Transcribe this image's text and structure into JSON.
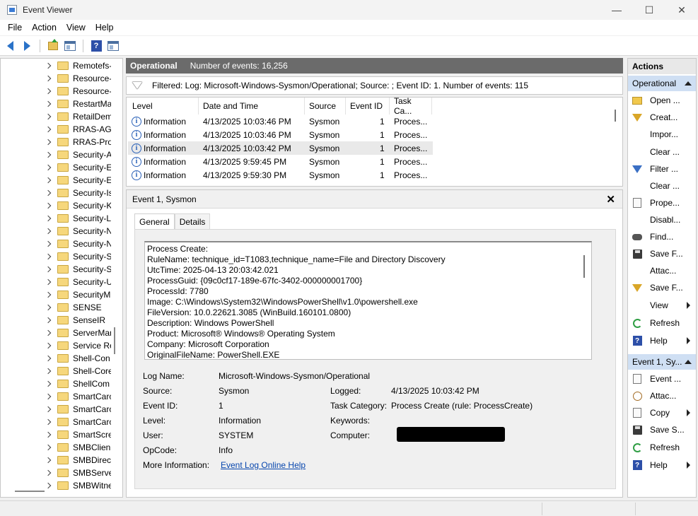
{
  "window": {
    "title": "Event Viewer",
    "controls": {
      "minimize": "—",
      "maximize": "☐",
      "close": "✕"
    }
  },
  "menu": [
    "File",
    "Action",
    "View",
    "Help"
  ],
  "toolbar": {
    "icons": [
      "back-arrow-icon",
      "forward-arrow-icon",
      "folder-up-icon",
      "show-hide-tree-icon",
      "help-icon",
      "show-hide-action-pane-icon"
    ],
    "help_glyph": "?"
  },
  "tree": {
    "items": [
      {
        "label": "Remotefs-",
        "chevron": true
      },
      {
        "label": "Resource-",
        "chevron": true
      },
      {
        "label": "Resource-",
        "chevron": true
      },
      {
        "label": "RestartMa",
        "chevron": true
      },
      {
        "label": "RetailDem",
        "chevron": true
      },
      {
        "label": "RRAS-AGI",
        "chevron": true
      },
      {
        "label": "RRAS-Pro",
        "chevron": true
      },
      {
        "label": "Security-A",
        "chevron": true
      },
      {
        "label": "Security-E",
        "chevron": true
      },
      {
        "label": "Security-E",
        "chevron": true
      },
      {
        "label": "Security-Is",
        "chevron": true
      },
      {
        "label": "Security-K",
        "chevron": true
      },
      {
        "label": "Security-L",
        "chevron": true
      },
      {
        "label": "Security-N",
        "chevron": true
      },
      {
        "label": "Security-N",
        "chevron": true
      },
      {
        "label": "Security-S",
        "chevron": true
      },
      {
        "label": "Security-S",
        "chevron": true
      },
      {
        "label": "Security-U",
        "chevron": true
      },
      {
        "label": "SecurityM",
        "chevron": true
      },
      {
        "label": "SENSE",
        "chevron": true
      },
      {
        "label": "SenseIR",
        "chevron": true
      },
      {
        "label": "ServerMar",
        "chevron": true
      },
      {
        "label": "Service Re",
        "chevron": true
      },
      {
        "label": "Shell-Con",
        "chevron": true
      },
      {
        "label": "Shell-Core",
        "chevron": true
      },
      {
        "label": "ShellCom",
        "chevron": true
      },
      {
        "label": "SmartCarc",
        "chevron": true
      },
      {
        "label": "SmartCarc",
        "chevron": true
      },
      {
        "label": "SmartCarc",
        "chevron": true
      },
      {
        "label": "SmartScre",
        "chevron": true
      },
      {
        "label": "SMBClien",
        "chevron": true
      },
      {
        "label": "SMBDirec",
        "chevron": true
      },
      {
        "label": "SMBServe",
        "chevron": true
      },
      {
        "label": "SMBWitne",
        "chevron": true
      }
    ]
  },
  "log_header": {
    "name": "Operational",
    "count_text": "Number of events: 16,256"
  },
  "filter_text": "Filtered: Log: Microsoft-Windows-Sysmon/Operational; Source: ; Event ID: 1. Number of events: 115",
  "events": {
    "columns": [
      "Level",
      "Date and Time",
      "Source",
      "Event ID",
      "Task Ca..."
    ],
    "rows": [
      {
        "level": "Information",
        "datetime": "4/13/2025 10:03:46 PM",
        "source": "Sysmon",
        "event_id": "1",
        "task": "Proces...",
        "selected": false
      },
      {
        "level": "Information",
        "datetime": "4/13/2025 10:03:46 PM",
        "source": "Sysmon",
        "event_id": "1",
        "task": "Proces...",
        "selected": false
      },
      {
        "level": "Information",
        "datetime": "4/13/2025 10:03:42 PM",
        "source": "Sysmon",
        "event_id": "1",
        "task": "Proces...",
        "selected": true
      },
      {
        "level": "Information",
        "datetime": "4/13/2025 9:59:45 PM",
        "source": "Sysmon",
        "event_id": "1",
        "task": "Proces...",
        "selected": false
      },
      {
        "level": "Information",
        "datetime": "4/13/2025 9:59:30 PM",
        "source": "Sysmon",
        "event_id": "1",
        "task": "Proces...",
        "selected": false
      }
    ],
    "info_glyph": "i"
  },
  "detail": {
    "title": "Event 1, Sysmon",
    "close_glyph": "✕",
    "tabs": [
      "General",
      "Details"
    ],
    "message": [
      "Process Create:",
      "RuleName: technique_id=T1083,technique_name=File and Directory Discovery",
      "UtcTime: 2025-04-13 20:03:42.021",
      "ProcessGuid: {09c0cf17-189e-67fc-3402-000000001700}",
      "ProcessId: 7780",
      "Image: C:\\Windows\\System32\\WindowsPowerShell\\v1.0\\powershell.exe",
      "FileVersion: 10.0.22621.3085 (WinBuild.160101.0800)",
      "Description: Windows PowerShell",
      "Product: Microsoft® Windows® Operating System",
      "Company: Microsoft Corporation",
      "OriginalFileName: PowerShell.EXE"
    ],
    "fields": {
      "log_name_label": "Log Name:",
      "log_name": "Microsoft-Windows-Sysmon/Operational",
      "source_label": "Source:",
      "source": "Sysmon",
      "logged_label": "Logged:",
      "logged": "4/13/2025 10:03:42 PM",
      "event_id_label": "Event ID:",
      "event_id": "1",
      "task_category_label": "Task Category:",
      "task_category": "Process Create (rule: ProcessCreate)",
      "level_label": "Level:",
      "level": "Information",
      "keywords_label": "Keywords:",
      "keywords": "",
      "user_label": "User:",
      "user": "SYSTEM",
      "computer_label": "Computer:",
      "opcode_label": "OpCode:",
      "opcode": "Info",
      "more_info_label": "More Information:",
      "more_info_link": "Event Log Online Help"
    }
  },
  "actions": {
    "title": "Actions",
    "sections": [
      {
        "name": "Operational",
        "items": [
          {
            "label": "Open ...",
            "icon": "folder-icon",
            "submenu": false
          },
          {
            "label": "Creat...",
            "icon": "create-filter-icon",
            "submenu": false
          },
          {
            "label": "Impor...",
            "icon": "",
            "submenu": false
          },
          {
            "label": "Clear ...",
            "icon": "",
            "submenu": false
          },
          {
            "label": "Filter ...",
            "icon": "filter-icon",
            "submenu": false
          },
          {
            "label": "Clear ...",
            "icon": "",
            "submenu": false
          },
          {
            "label": "Prope...",
            "icon": "properties-icon",
            "submenu": false
          },
          {
            "label": "Disabl...",
            "icon": "",
            "submenu": false
          },
          {
            "label": "Find...",
            "icon": "binoculars-icon",
            "submenu": false
          },
          {
            "label": "Save F...",
            "icon": "save-icon",
            "submenu": false
          },
          {
            "label": "Attac...",
            "icon": "",
            "submenu": false
          },
          {
            "label": "Save F...",
            "icon": "save-filter-icon",
            "submenu": false
          },
          {
            "label": "View",
            "icon": "",
            "submenu": true
          },
          {
            "label": "Refresh",
            "icon": "refresh-icon",
            "submenu": false
          },
          {
            "label": "Help",
            "icon": "help-icon",
            "submenu": true
          }
        ]
      },
      {
        "name": "Event 1, Sy...",
        "items": [
          {
            "label": "Event ...",
            "icon": "event-properties-icon",
            "submenu": false
          },
          {
            "label": "Attac...",
            "icon": "attach-task-icon",
            "submenu": false
          },
          {
            "label": "Copy",
            "icon": "copy-icon",
            "submenu": true
          },
          {
            "label": "Save S...",
            "icon": "save-icon",
            "submenu": false
          },
          {
            "label": "Refresh",
            "icon": "refresh-icon",
            "submenu": false
          },
          {
            "label": "Help",
            "icon": "help-icon",
            "submenu": true
          }
        ]
      }
    ]
  },
  "colors": {
    "header_bg": "#6b6b6b",
    "actions_section_bg": "#cfdff3",
    "link": "#0645ad",
    "info_blue": "#2a61b8"
  }
}
